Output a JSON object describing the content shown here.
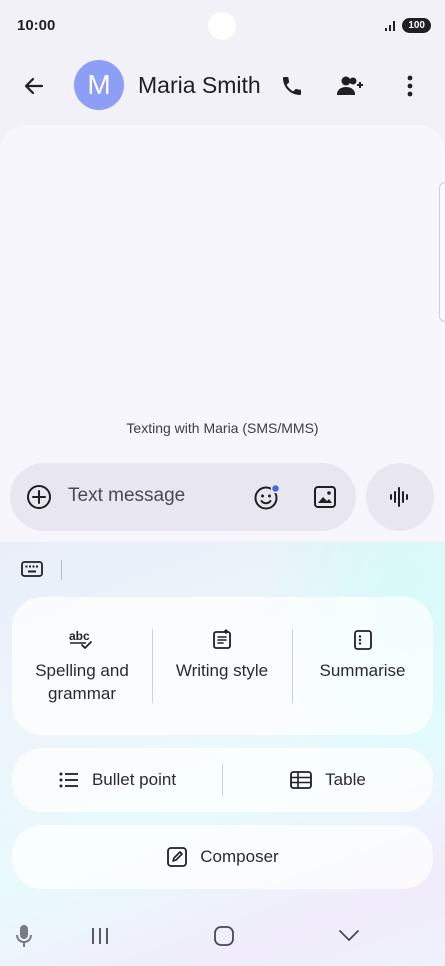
{
  "status": {
    "time": "10:00",
    "battery": "100"
  },
  "header": {
    "avatar_letter": "M",
    "contact_name": "Maria Smith"
  },
  "chat": {
    "info": "Texting with Maria (SMS/MMS)"
  },
  "compose": {
    "placeholder": "Text message",
    "value": ""
  },
  "ai_tools": {
    "spelling": "Spelling and grammar",
    "writing_style": "Writing style",
    "summarise": "Summarise",
    "bullet_point": "Bullet point",
    "table": "Table",
    "composer": "Composer"
  },
  "colors": {
    "avatar": "#8c9ef6",
    "accent_dot": "#3d6fd8"
  }
}
